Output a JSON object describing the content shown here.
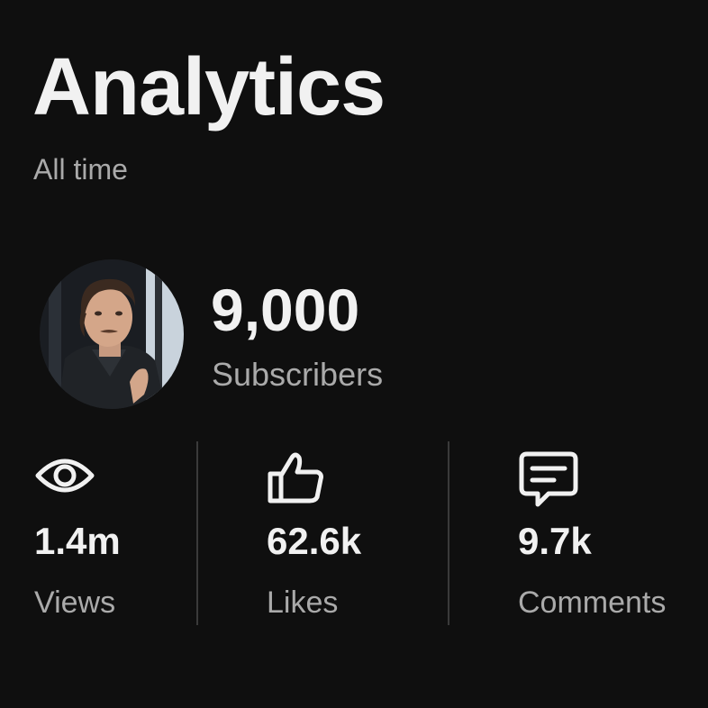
{
  "header": {
    "title": "Analytics",
    "period": "All time"
  },
  "channel": {
    "subscriber_count": "9,000",
    "subscriber_label": "Subscribers",
    "avatar_icon": "profile-photo"
  },
  "stats": [
    {
      "icon": "eye-icon",
      "value": "1.4m",
      "label": "Views"
    },
    {
      "icon": "thumbs-up-icon",
      "value": "62.6k",
      "label": "Likes"
    },
    {
      "icon": "comment-icon",
      "value": "9.7k",
      "label": "Comments"
    }
  ],
  "colors": {
    "background": "#0f0f0f",
    "primary_text": "#f1f1f1",
    "secondary_text": "#aaaaaa",
    "divider": "#3a3a3a"
  }
}
